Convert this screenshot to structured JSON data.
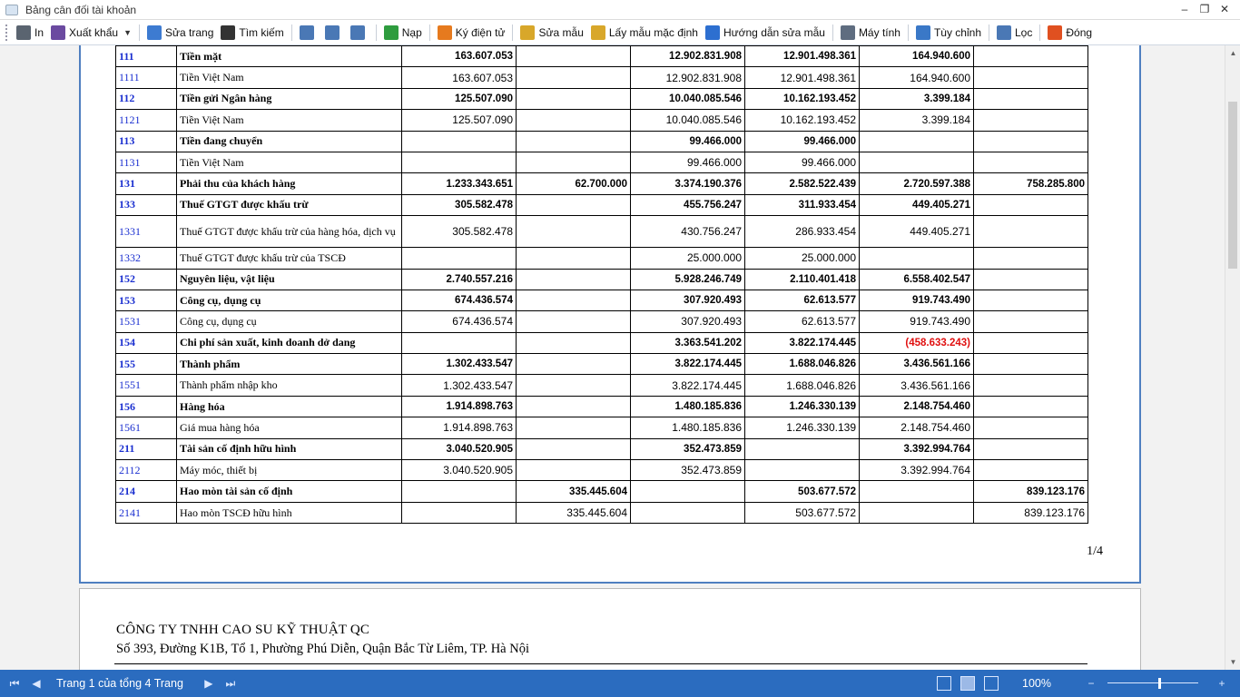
{
  "window": {
    "title": "Bảng cân đối tài khoản"
  },
  "toolbar": {
    "items": [
      {
        "label": "In",
        "icon": "printer-icon",
        "color": "#5a6470"
      },
      {
        "label": "Xuất khẩu",
        "icon": "save-icon",
        "color": "#6b4aa0",
        "dropdown": true
      },
      {
        "label": "Sửa trang",
        "icon": "edit-page-icon",
        "color": "#3d7bd1"
      },
      {
        "label": "Tìm kiếm",
        "icon": "binoculars-icon",
        "color": "#333333"
      },
      {
        "label": "",
        "icon": "view-1-icon",
        "color": "#4a78b5"
      },
      {
        "label": "",
        "icon": "view-2-icon",
        "color": "#4a78b5"
      },
      {
        "label": "",
        "icon": "view-3-icon",
        "color": "#4a78b5"
      },
      {
        "label": "Nạp",
        "icon": "refresh-icon",
        "color": "#2e9c3e"
      },
      {
        "label": "Ký điện tử",
        "icon": "signature-icon",
        "color": "#e67a1e"
      },
      {
        "label": "Sửa mẫu",
        "icon": "ruler-icon",
        "color": "#d8a72a"
      },
      {
        "label": "Lấy mẫu mặc định",
        "icon": "ruler-default-icon",
        "color": "#d8a72a"
      },
      {
        "label": "Hướng dẫn sửa mẫu",
        "icon": "help-icon",
        "color": "#2d6fd0"
      },
      {
        "label": "Máy tính",
        "icon": "calculator-icon",
        "color": "#5f6d80"
      },
      {
        "label": "Tùy chỉnh",
        "icon": "customize-icon",
        "color": "#3a78c7"
      },
      {
        "label": "Lọc",
        "icon": "filter-icon",
        "color": "#4a78b5"
      },
      {
        "label": "Đóng",
        "icon": "close-icon",
        "color": "#e05020"
      }
    ]
  },
  "report": {
    "rows": [
      {
        "code": "111",
        "name": "Tiền mặt",
        "bold": true,
        "v": [
          "163.607.053",
          "",
          "12.902.831.908",
          "12.901.498.361",
          "164.940.600",
          ""
        ]
      },
      {
        "code": "1111",
        "name": "Tiền Việt Nam",
        "bold": false,
        "v": [
          "163.607.053",
          "",
          "12.902.831.908",
          "12.901.498.361",
          "164.940.600",
          ""
        ]
      },
      {
        "code": "112",
        "name": "Tiền gửi Ngân hàng",
        "bold": true,
        "v": [
          "125.507.090",
          "",
          "10.040.085.546",
          "10.162.193.452",
          "3.399.184",
          ""
        ]
      },
      {
        "code": "1121",
        "name": "Tiền Việt Nam",
        "bold": false,
        "v": [
          "125.507.090",
          "",
          "10.040.085.546",
          "10.162.193.452",
          "3.399.184",
          ""
        ]
      },
      {
        "code": "113",
        "name": "Tiền đang chuyển",
        "bold": true,
        "v": [
          "",
          "",
          "99.466.000",
          "99.466.000",
          "",
          ""
        ]
      },
      {
        "code": "1131",
        "name": "Tiền Việt Nam",
        "bold": false,
        "v": [
          "",
          "",
          "99.466.000",
          "99.466.000",
          "",
          ""
        ]
      },
      {
        "code": "131",
        "name": "Phải thu của khách hàng",
        "bold": true,
        "v": [
          "1.233.343.651",
          "62.700.000",
          "3.374.190.376",
          "2.582.522.439",
          "2.720.597.388",
          "758.285.800"
        ]
      },
      {
        "code": "133",
        "name": "Thuế GTGT được khấu trừ",
        "bold": true,
        "v": [
          "305.582.478",
          "",
          "455.756.247",
          "311.933.454",
          "449.405.271",
          ""
        ]
      },
      {
        "code": "1331",
        "name": "Thuế GTGT được khấu trừ của hàng hóa, dịch vụ",
        "bold": false,
        "tall": true,
        "v": [
          "305.582.478",
          "",
          "430.756.247",
          "286.933.454",
          "449.405.271",
          ""
        ]
      },
      {
        "code": "1332",
        "name": "Thuế GTGT được khấu trừ của TSCĐ",
        "bold": false,
        "v": [
          "",
          "",
          "25.000.000",
          "25.000.000",
          "",
          ""
        ]
      },
      {
        "code": "152",
        "name": "Nguyên liệu, vật liệu",
        "bold": true,
        "v": [
          "2.740.557.216",
          "",
          "5.928.246.749",
          "2.110.401.418",
          "6.558.402.547",
          ""
        ]
      },
      {
        "code": "153",
        "name": "Công cụ, dụng cụ",
        "bold": true,
        "v": [
          "674.436.574",
          "",
          "307.920.493",
          "62.613.577",
          "919.743.490",
          ""
        ]
      },
      {
        "code": "1531",
        "name": "Công cụ, dụng cụ",
        "bold": false,
        "v": [
          "674.436.574",
          "",
          "307.920.493",
          "62.613.577",
          "919.743.490",
          ""
        ]
      },
      {
        "code": "154",
        "name": "Chi phí sản xuất, kinh doanh dở dang",
        "bold": true,
        "v": [
          "",
          "",
          "3.363.541.202",
          "3.822.174.445",
          "(458.633.243)",
          ""
        ],
        "neg": 4
      },
      {
        "code": "155",
        "name": "Thành phẩm",
        "bold": true,
        "v": [
          "1.302.433.547",
          "",
          "3.822.174.445",
          "1.688.046.826",
          "3.436.561.166",
          ""
        ]
      },
      {
        "code": "1551",
        "name": "Thành phẩm nhập kho",
        "bold": false,
        "v": [
          "1.302.433.547",
          "",
          "3.822.174.445",
          "1.688.046.826",
          "3.436.561.166",
          ""
        ]
      },
      {
        "code": "156",
        "name": "Hàng hóa",
        "bold": true,
        "v": [
          "1.914.898.763",
          "",
          "1.480.185.836",
          "1.246.330.139",
          "2.148.754.460",
          ""
        ]
      },
      {
        "code": "1561",
        "name": "Giá mua hàng hóa",
        "bold": false,
        "v": [
          "1.914.898.763",
          "",
          "1.480.185.836",
          "1.246.330.139",
          "2.148.754.460",
          ""
        ]
      },
      {
        "code": "211",
        "name": "Tài sản cố định hữu hình",
        "bold": true,
        "v": [
          "3.040.520.905",
          "",
          "352.473.859",
          "",
          "3.392.994.764",
          ""
        ]
      },
      {
        "code": "2112",
        "name": "Máy móc, thiết bị",
        "bold": false,
        "v": [
          "3.040.520.905",
          "",
          "352.473.859",
          "",
          "3.392.994.764",
          ""
        ]
      },
      {
        "code": "214",
        "name": "Hao mòn tài sản cố định",
        "bold": true,
        "v": [
          "",
          "335.445.604",
          "",
          "503.677.572",
          "",
          "839.123.176"
        ]
      },
      {
        "code": "2141",
        "name": "Hao mòn TSCĐ hữu hình",
        "bold": false,
        "v": [
          "",
          "335.445.604",
          "",
          "503.677.572",
          "",
          "839.123.176"
        ]
      }
    ],
    "page_number": "1/4",
    "page2_company": "CÔNG TY TNHH CAO SU KỸ THUẬT QC",
    "page2_address": "Số 393, Đường K1B, Tổ 1, Phường Phú Diễn, Quận Bắc Từ Liêm, TP. Hà Nội"
  },
  "statusbar": {
    "pages_label": "Trang 1 của tổng 4 Trang",
    "zoom": "100%",
    "zoom_fraction": 0.56
  },
  "colors": {
    "accent": "#2b6cbf",
    "page_border": "#4f7fc0",
    "code_blue": "#1a2fd0",
    "negative": "#e01010"
  }
}
